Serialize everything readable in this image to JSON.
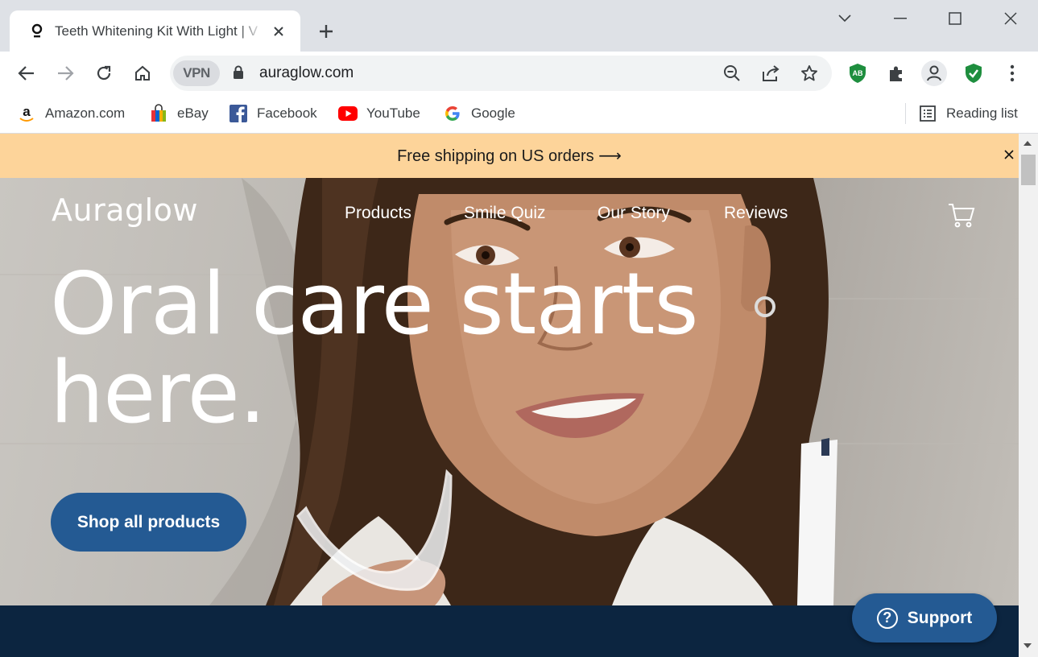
{
  "tab": {
    "title": "Teeth Whitening Kit With Light | V"
  },
  "toolbar": {
    "vpn_label": "VPN",
    "url": "auraglow.com"
  },
  "bookmarks": [
    {
      "label": "Amazon.com",
      "icon": "amazon-icon"
    },
    {
      "label": "eBay",
      "icon": "ebay-icon"
    },
    {
      "label": "Facebook",
      "icon": "facebook-icon"
    },
    {
      "label": "YouTube",
      "icon": "youtube-icon"
    },
    {
      "label": "Google",
      "icon": "google-icon"
    }
  ],
  "reading_list": "Reading list",
  "page": {
    "announcement": "Free shipping on US orders ⟶",
    "logo": "Auraglow",
    "nav": [
      "Products",
      "Smile Quiz",
      "Our Story",
      "Reviews"
    ],
    "headline_line1": "Oral care starts",
    "headline_line2": "here.",
    "cta": "Shop all products",
    "support": "Support"
  },
  "colors": {
    "announcement_bg": "#fdd49a",
    "cta_bg": "#245a93",
    "footer_band": "#0c2540",
    "extension_green": "#1e8e3e"
  }
}
